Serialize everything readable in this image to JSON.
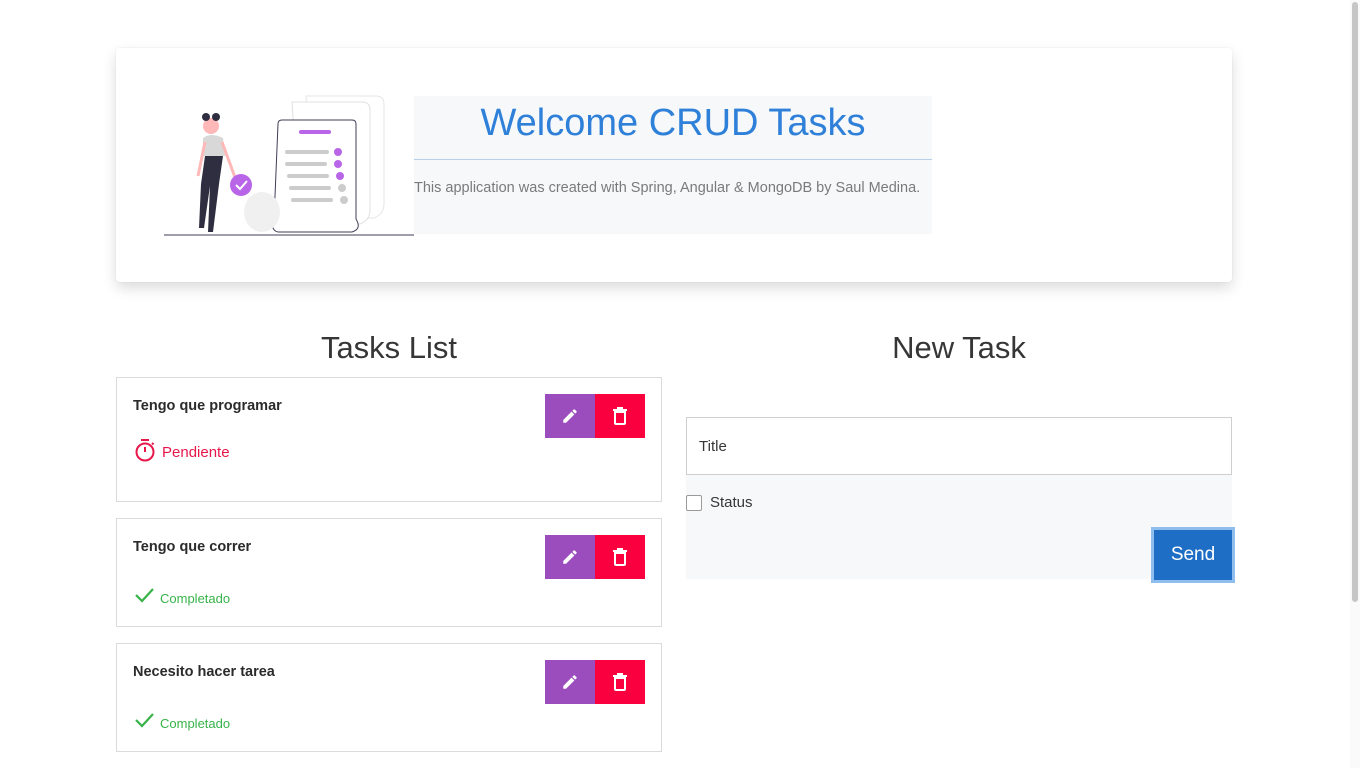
{
  "hero": {
    "title": "Welcome CRUD Tasks",
    "subtitle": "This application was created with Spring, Angular & MongoDB by Saul Medina."
  },
  "tasks_list": {
    "heading": "Tasks List",
    "tasks": [
      {
        "title": "Tengo que programar",
        "status_label": "Pendiente",
        "status_icon": "stopwatch-icon",
        "completed": false
      },
      {
        "title": "Tengo que correr",
        "status_label": "Completado",
        "status_icon": "check-icon",
        "completed": true
      },
      {
        "title": "Necesito hacer tarea",
        "status_label": "Completado",
        "status_icon": "check-icon",
        "completed": true
      }
    ],
    "edit_icon": "pencil-icon",
    "delete_icon": "trash-icon"
  },
  "new_task": {
    "heading": "New Task",
    "title_placeholder": "Title",
    "title_value": "",
    "status_label": "Status",
    "status_checked": false,
    "send_label": "Send"
  },
  "colors": {
    "accent_title": "#2f80d9",
    "edit_button": "#9b4dbd",
    "delete_button": "#fa003f",
    "pending": "#e8174a",
    "completed": "#37b34a",
    "send_button": "#1f6ec5"
  }
}
